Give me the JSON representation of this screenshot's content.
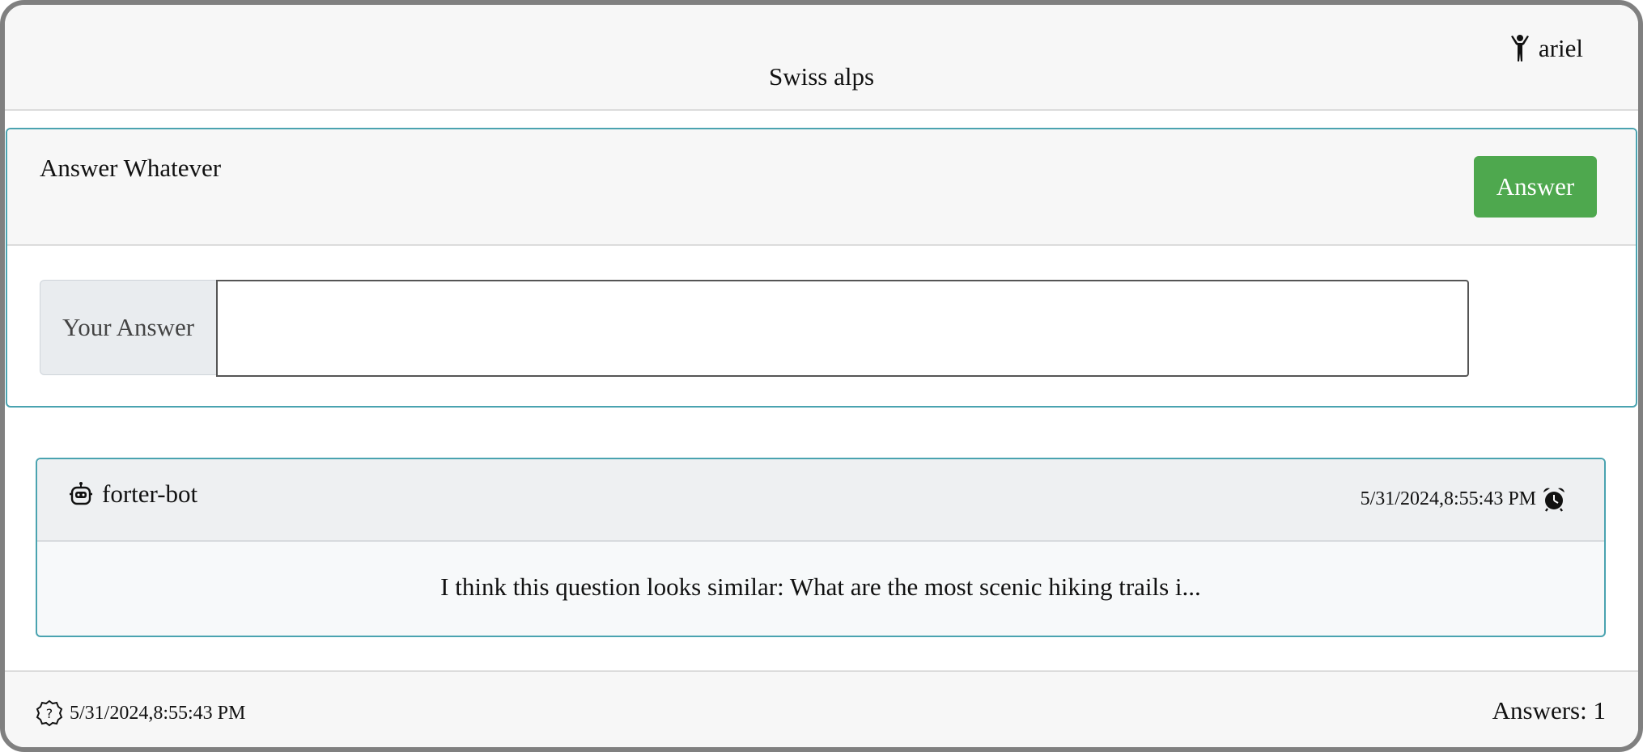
{
  "header": {
    "title": "Swiss alps",
    "user_name": "ariel",
    "user_icon": "person-icon"
  },
  "answer_form": {
    "heading": "Answer Whatever",
    "submit_label": "Answer",
    "submit_color": "#4ea84e",
    "input_label": "Your Answer",
    "input_value": "",
    "input_placeholder": ""
  },
  "answers": [
    {
      "author": "forter-bot",
      "author_icon": "robot-icon",
      "timestamp": "5/31/2024,8:55:43 PM",
      "time_icon": "alarm-clock-icon",
      "text": "I think this question looks similar: What are the most scenic hiking trails i..."
    }
  ],
  "footer": {
    "question_icon": "question-circle-icon",
    "date": "5/31/2024,8:55:43 PM",
    "answers_count": "Answers: 1"
  },
  "colors": {
    "accent_border": "#4aa3b0",
    "card_border": "#808080"
  }
}
